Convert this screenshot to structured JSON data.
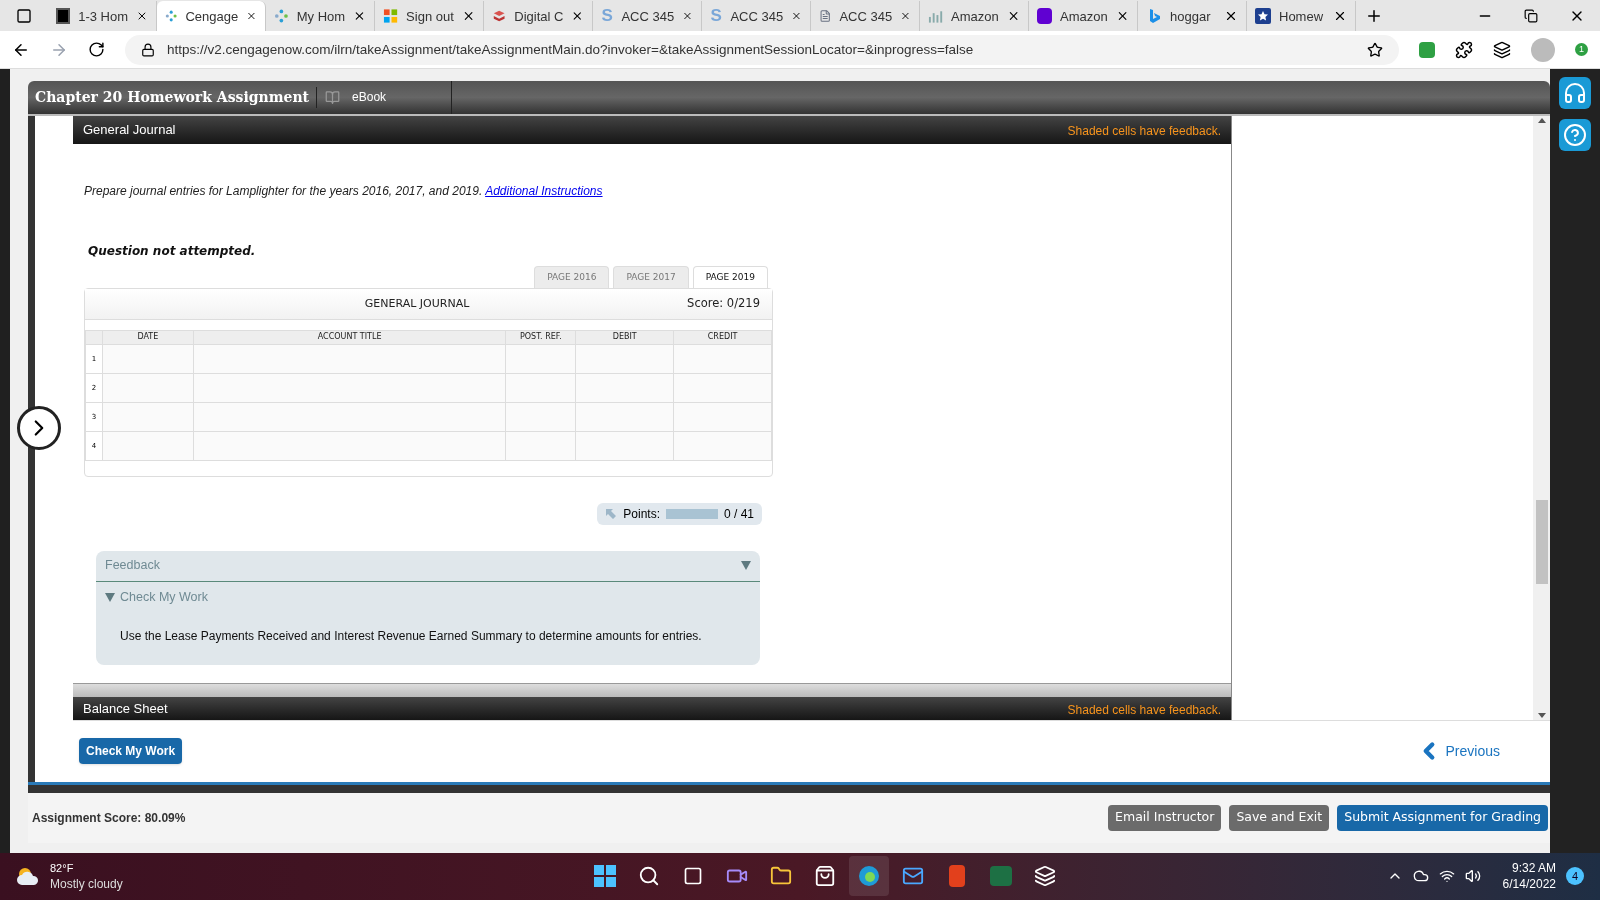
{
  "browser": {
    "tabs": [
      {
        "title": "1-3 Hom",
        "selected": false,
        "kind": "square"
      },
      {
        "title": "Cengage",
        "selected": true,
        "kind": "dots"
      },
      {
        "title": "My Hom",
        "selected": false,
        "kind": "dots"
      },
      {
        "title": "Sign out",
        "selected": false,
        "kind": "windows"
      },
      {
        "title": "Digital C",
        "selected": false,
        "kind": "book"
      },
      {
        "title": "ACC 345",
        "selected": false,
        "kind": "letter",
        "letter": "S"
      },
      {
        "title": "ACC 345",
        "selected": false,
        "kind": "letter",
        "letter": "S"
      },
      {
        "title": "ACC 345",
        "selected": false,
        "kind": "document"
      },
      {
        "title": "Amazon",
        "selected": false,
        "kind": "chart"
      },
      {
        "title": "Amazon",
        "selected": false,
        "kind": "tile"
      },
      {
        "title": "hoggar",
        "selected": false,
        "kind": "bing"
      },
      {
        "title": "Homew",
        "selected": false,
        "kind": "star"
      }
    ],
    "address": "https://v2.cengagenow.com/ilrn/takeAssignment/takeAssignmentMain.do?invoker=&takeAssignmentSessionLocator=&inprogress=false",
    "extension_badge": "1"
  },
  "assignment": {
    "title": "Chapter 20 Homework Assignment",
    "ebook": "eBook"
  },
  "journal_panel": {
    "title": "General Journal",
    "notice": "Shaded cells have feedback.",
    "instructions": "Prepare journal entries for Lamplighter for the years 2016, 2017, and 2019.",
    "link": "Additional Instructions",
    "status": "Question not attempted.",
    "page_tabs": [
      {
        "label": "PAGE 2016",
        "selected": false
      },
      {
        "label": "PAGE 2017",
        "selected": false
      },
      {
        "label": "PAGE 2019",
        "selected": true
      }
    ],
    "table": {
      "title": "GENERAL JOURNAL",
      "score": "Score: 0/219",
      "columns": [
        "DATE",
        "ACCOUNT TITLE",
        "POST. REF.",
        "DEBIT",
        "CREDIT"
      ],
      "rows": [
        "1",
        "2",
        "3",
        "4"
      ]
    },
    "points": {
      "label": "Points:",
      "reading": "0 / 41"
    },
    "feedback": {
      "title": "Feedback",
      "expanded": true,
      "section": {
        "title": "Check My Work",
        "expanded": true,
        "text": "Use the Lease Payments Received and Interest Revenue Earned Summary to determine amounts for entries."
      }
    }
  },
  "next_panel": {
    "title": "Balance Sheet",
    "notice": "Shaded cells have feedback."
  },
  "nav": {
    "check": "Check My Work",
    "previous": "Previous"
  },
  "footer": {
    "score": "Assignment Score: 80.09%",
    "buttons": [
      "Email Instructor",
      "Save and Exit",
      "Submit Assignment for Grading"
    ]
  },
  "taskbar": {
    "temperature": "82°F",
    "weather": "Mostly cloudy",
    "time": "9:32 AM",
    "date": "6/14/2022",
    "notifications": "4"
  }
}
